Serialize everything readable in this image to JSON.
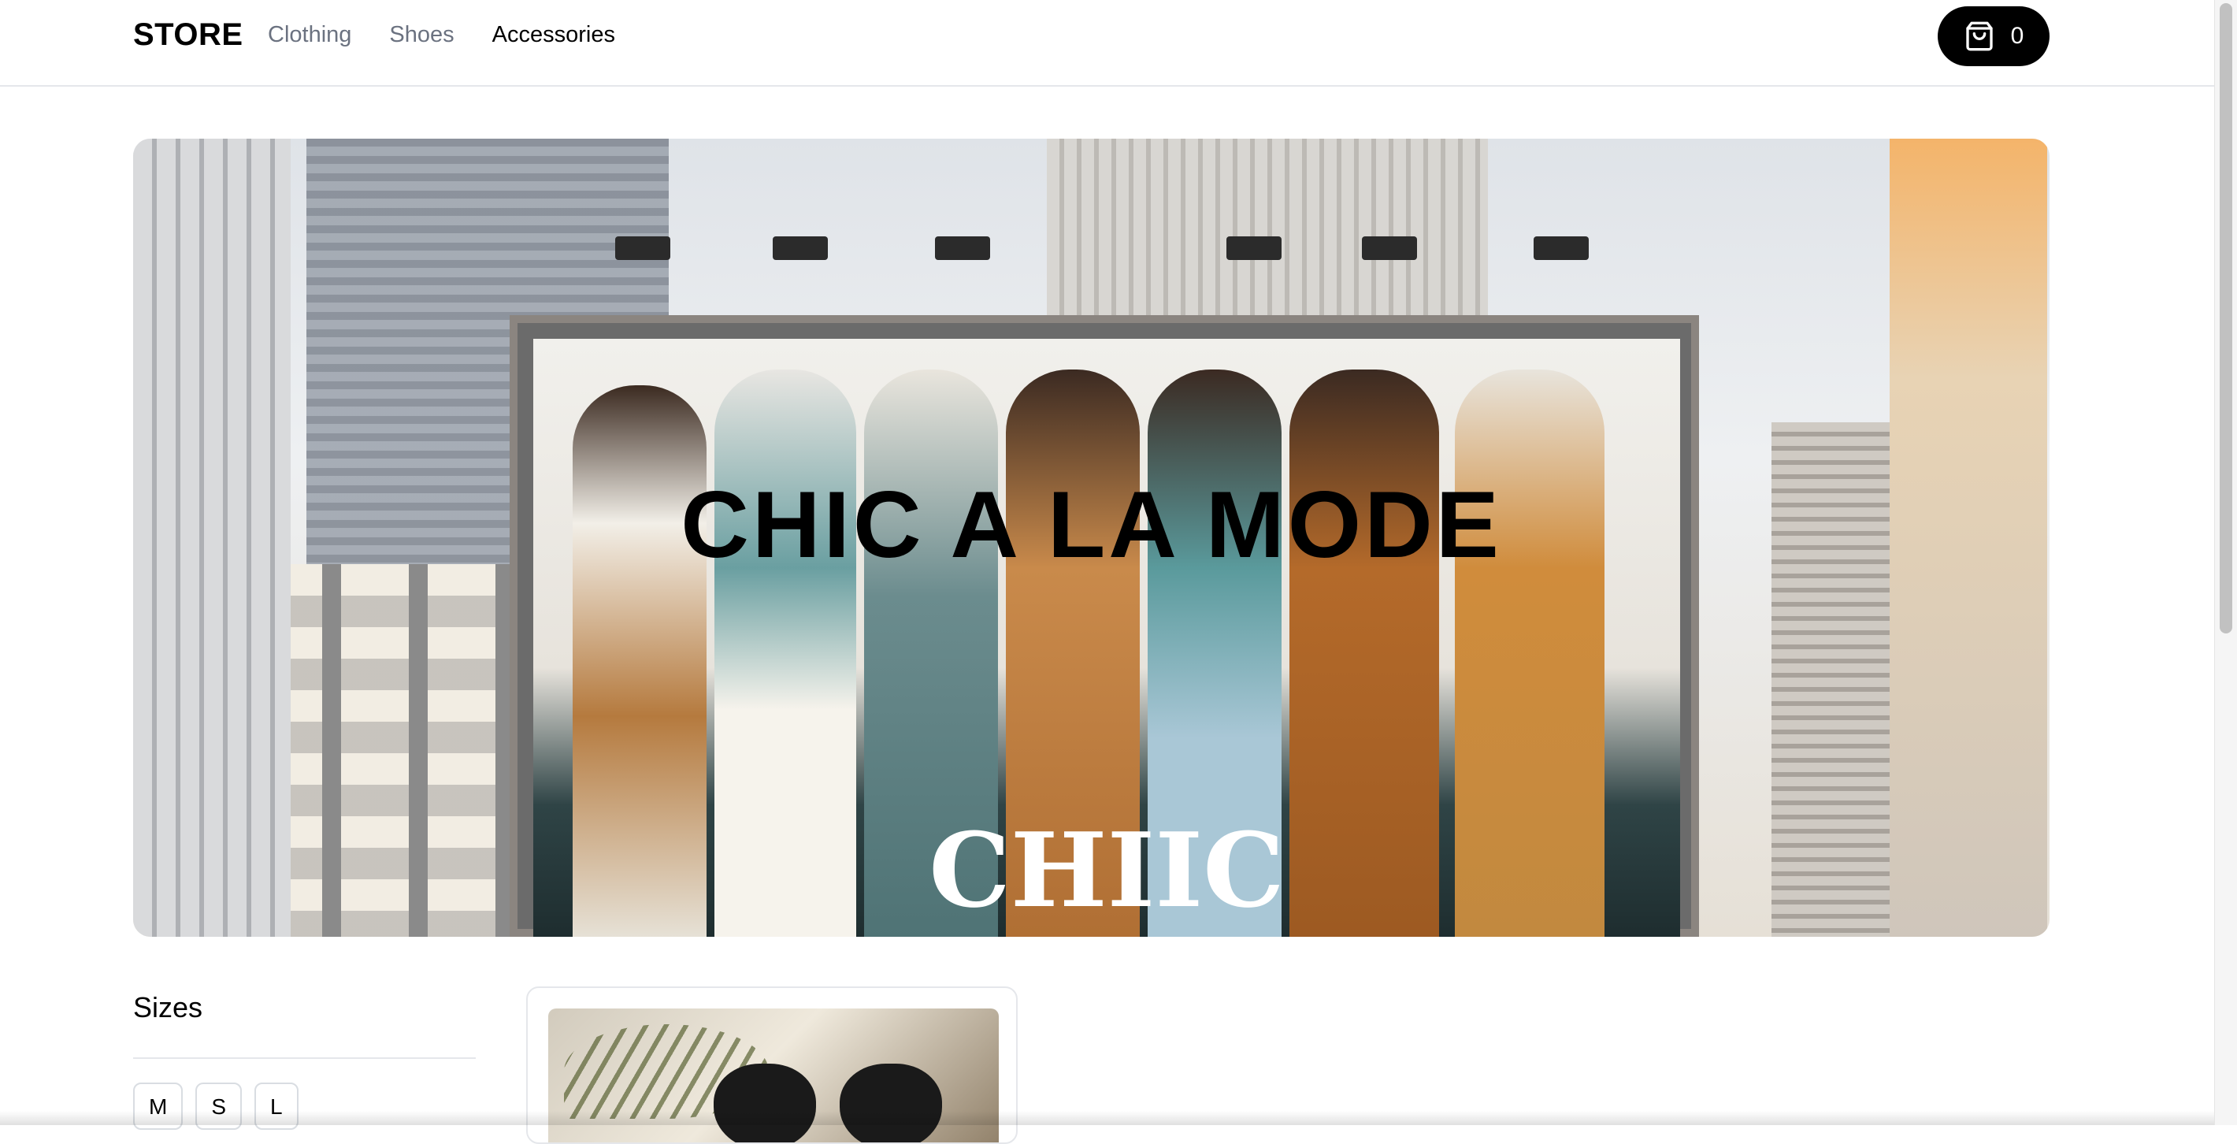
{
  "header": {
    "brand": "STORE",
    "nav": [
      {
        "label": "Clothing",
        "state": "muted"
      },
      {
        "label": "Shoes",
        "state": "muted"
      },
      {
        "label": "Accessories",
        "state": "active"
      }
    ],
    "cart": {
      "icon": "shopping-bag-icon",
      "count": "0"
    }
  },
  "hero": {
    "title": "CHIC A LA MODE",
    "sign_text": "CHIIC"
  },
  "filters": {
    "sizes_title": "Sizes",
    "sizes": [
      "M",
      "S",
      "L"
    ]
  },
  "products": [
    {
      "image": "sunglasses-on-leaf-image"
    }
  ],
  "colors": {
    "primary": "#000000",
    "muted_text": "#6b7280",
    "border": "#e5e7eb"
  }
}
